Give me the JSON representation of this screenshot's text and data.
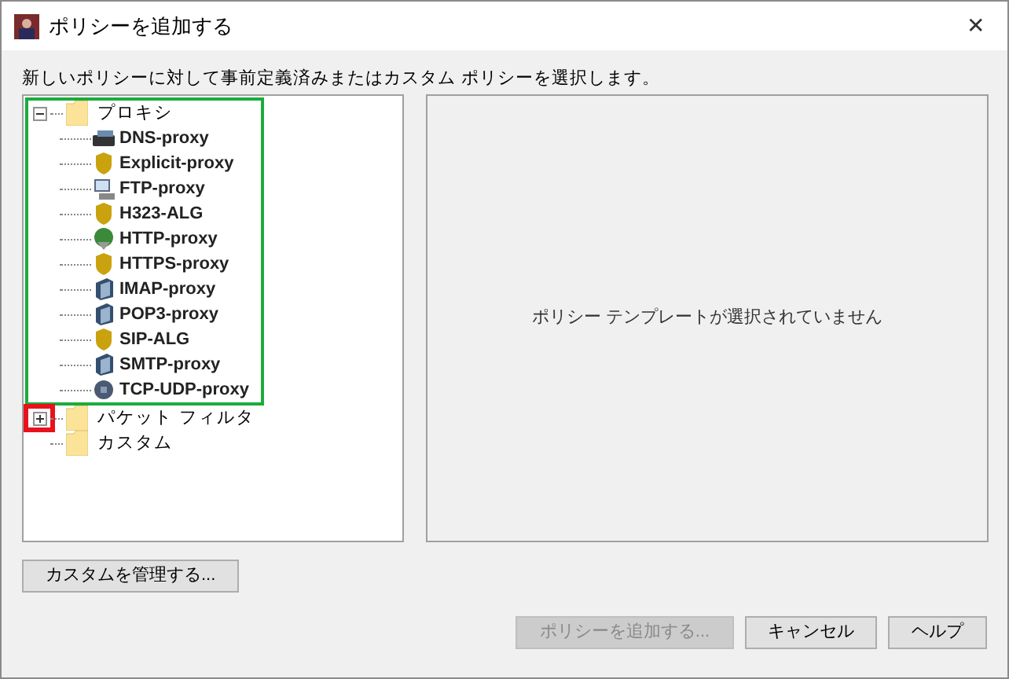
{
  "window": {
    "title": "ポリシーを追加する",
    "close": "✕"
  },
  "instruction": "新しいポリシーに対して事前定義済みまたはカスタム ポリシーを選択します。",
  "tree": [
    {
      "label": "プロキシ",
      "expanded": true,
      "color": "#1aac3c",
      "children": [
        {
          "label": "DNS-proxy",
          "kind": "drive"
        },
        {
          "label": "Explicit-proxy",
          "kind": "shield"
        },
        {
          "label": "FTP-proxy",
          "kind": "computer"
        },
        {
          "label": "H323-ALG",
          "kind": "shield"
        },
        {
          "label": "HTTP-proxy",
          "kind": "globe"
        },
        {
          "label": "HTTPS-proxy",
          "kind": "shield"
        },
        {
          "label": "IMAP-proxy",
          "kind": "mail"
        },
        {
          "label": "POP3-proxy",
          "kind": "mail"
        },
        {
          "label": "SIP-ALG",
          "kind": "shield"
        },
        {
          "label": "SMTP-proxy",
          "kind": "mail"
        },
        {
          "label": "TCP-UDP-proxy",
          "kind": "ball"
        }
      ]
    },
    {
      "label": "パケット フィルタ",
      "expanded": false,
      "color": "#e8121c"
    },
    {
      "label": "カスタム"
    }
  ],
  "preview": {
    "message": "ポリシー テンプレートが選択されていません"
  },
  "manage_button": "カスタムを管理する...",
  "buttons": [
    {
      "label": "ポリシーを追加する...",
      "disabled": true
    },
    {
      "label": "キャンセル",
      "disabled": false
    },
    {
      "label": "ヘルプ",
      "disabled": false
    }
  ]
}
